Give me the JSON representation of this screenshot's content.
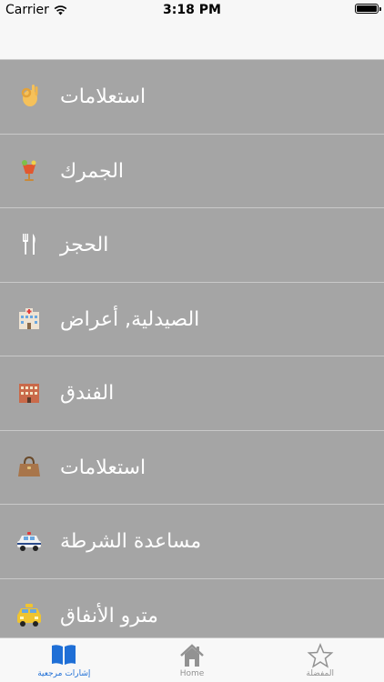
{
  "status_bar": {
    "carrier": "Carrier",
    "time": "3:18 PM"
  },
  "list": {
    "items": [
      {
        "label": "استعلامات",
        "icon": "ok-hand-icon"
      },
      {
        "label": "الجمرك",
        "icon": "cocktail-icon"
      },
      {
        "label": "الحجز",
        "icon": "fork-knife-icon"
      },
      {
        "label": "الصيدلية, أعراض",
        "icon": "hospital-icon"
      },
      {
        "label": "الفندق",
        "icon": "hotel-icon"
      },
      {
        "label": "استعلامات",
        "icon": "handbag-icon"
      },
      {
        "label": "مساعدة الشرطة",
        "icon": "police-car-icon"
      },
      {
        "label": "مترو الأنفاق",
        "icon": "taxi-icon"
      }
    ]
  },
  "tab_bar": {
    "tabs": [
      {
        "label": "إشارات مرجعية",
        "icon": "book-icon",
        "active": true
      },
      {
        "label": "Home",
        "icon": "home-icon",
        "active": false
      },
      {
        "label": "المفضلة",
        "icon": "star-icon",
        "active": false
      }
    ]
  },
  "colors": {
    "list_background": "#a5a5a5",
    "active_tab": "#1f6fd6",
    "inactive_tab": "#929292"
  }
}
